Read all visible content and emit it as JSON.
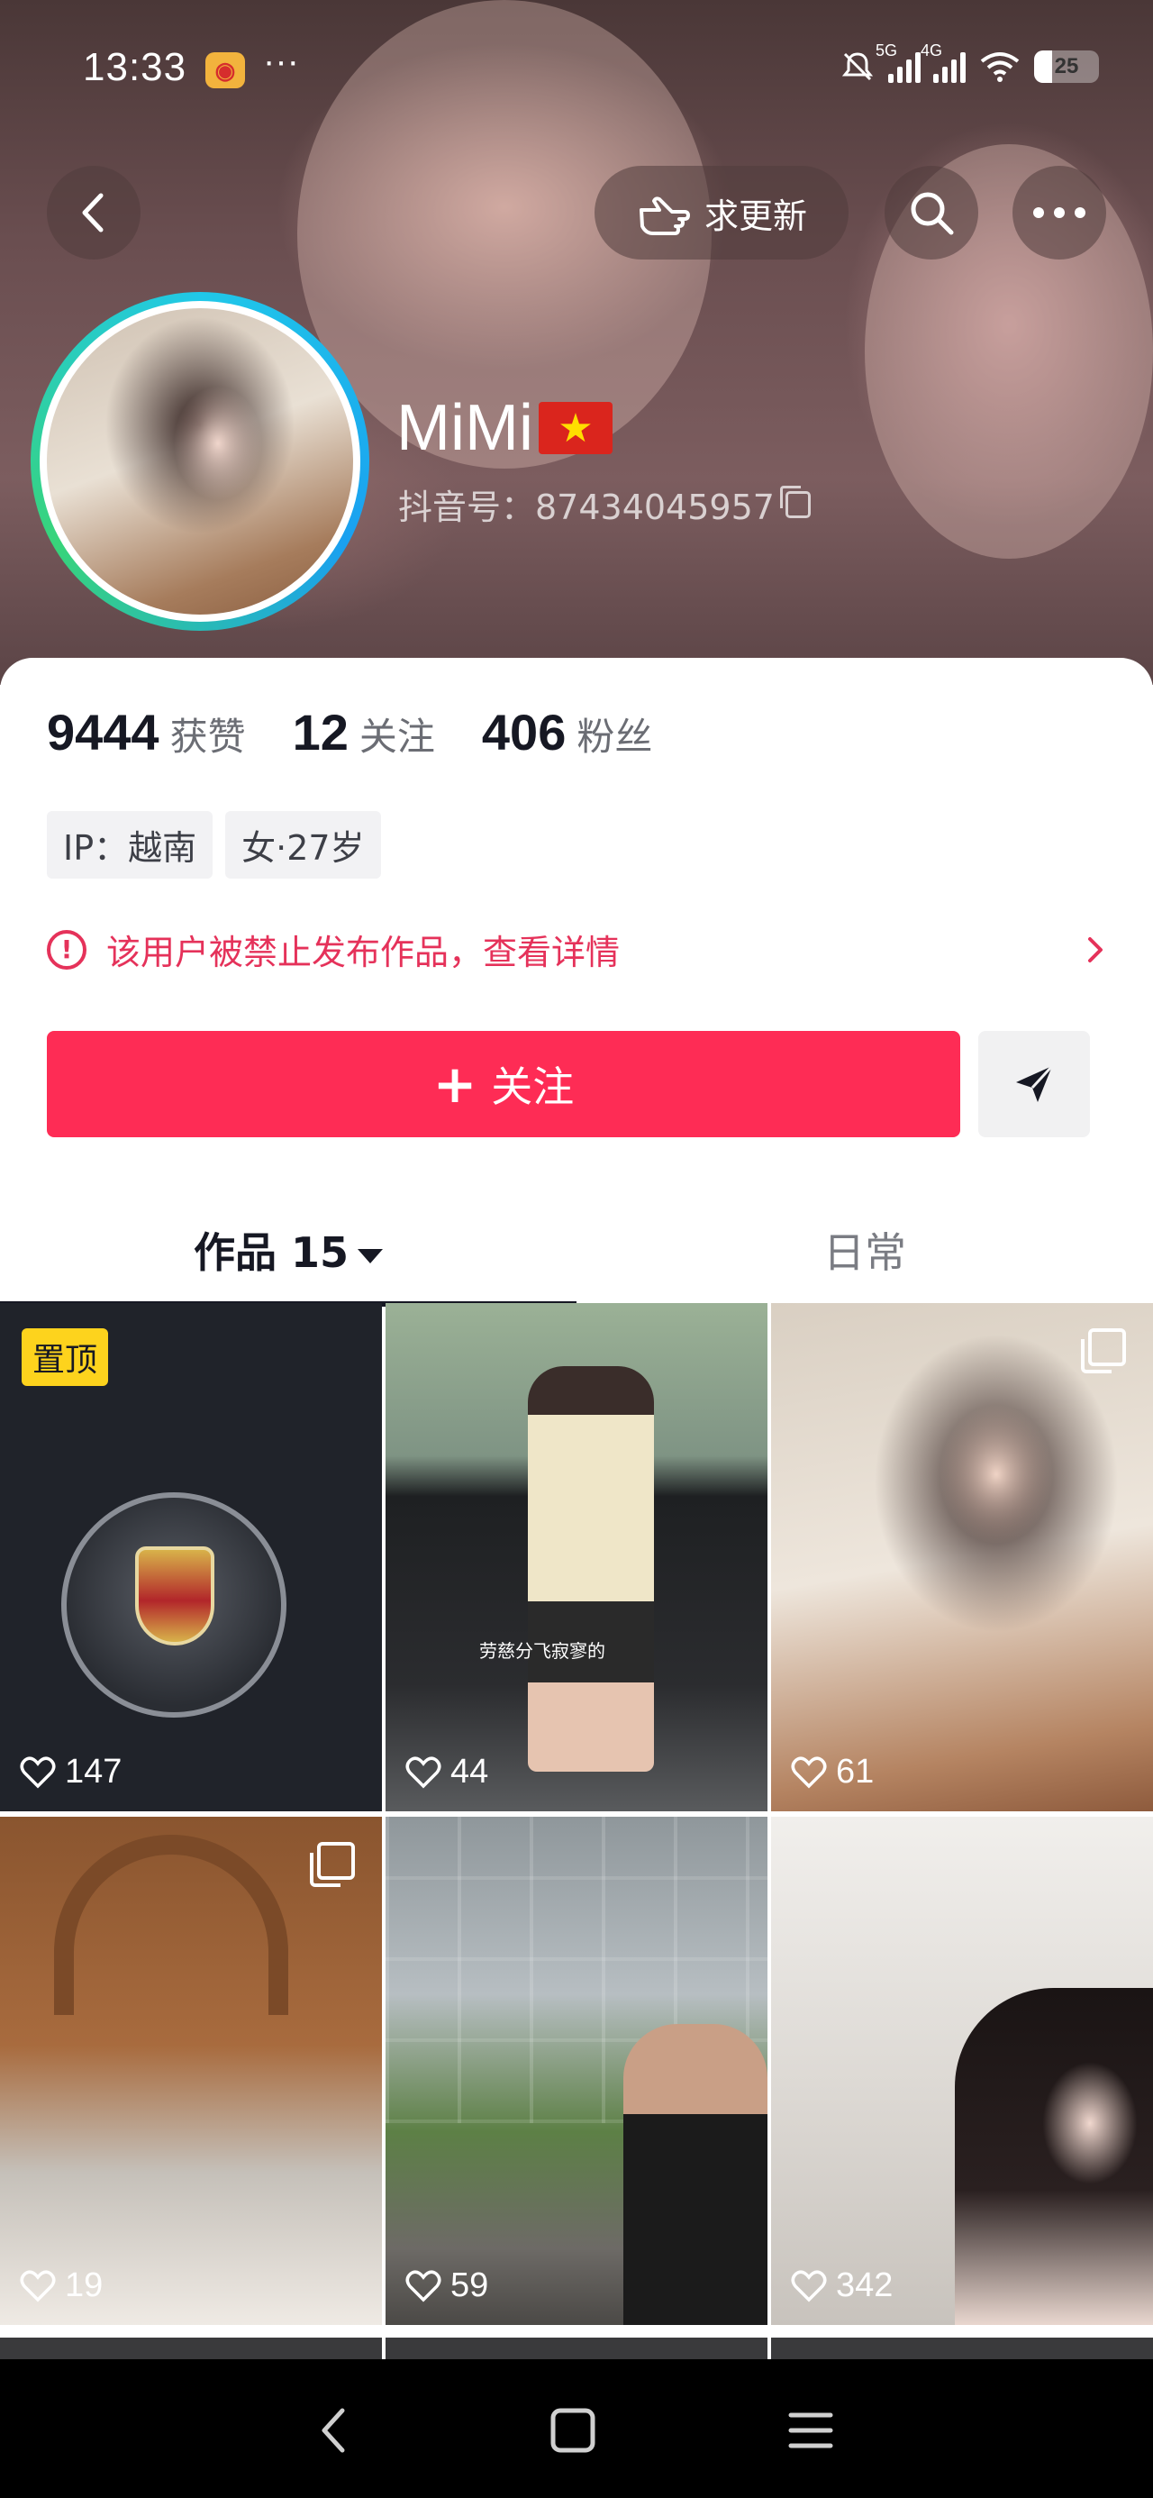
{
  "status_bar": {
    "time": "13:33",
    "app_icon": "weibo-icon",
    "more_dots": "···",
    "network_5g": "5G",
    "network_4g": "4G",
    "battery": "25"
  },
  "header": {
    "back_icon": "back-arrow-icon",
    "request_update_label": "求更新",
    "search_icon": "search-icon",
    "more_icon": "more-icon"
  },
  "profile": {
    "name": "MiMi",
    "flag": "vietnam-flag",
    "douyin_id_label": "抖音号：87434045957"
  },
  "stats": [
    {
      "value": "9444",
      "label": "获赞"
    },
    {
      "value": "12",
      "label": "关注"
    },
    {
      "value": "406",
      "label": "粉丝"
    }
  ],
  "tags": [
    "IP：越南",
    "女·27岁"
  ],
  "notice": {
    "text": "该用户被禁止发布作品，查看详情"
  },
  "actions": {
    "follow_label": "关注",
    "follow_color": "#fe2c55"
  },
  "tabs": {
    "works_label": "作品 15",
    "daily_label": "日常"
  },
  "grid": {
    "pinned_label": "置顶",
    "caption": "劳慈分飞寂寥的",
    "items": [
      {
        "likes": "147"
      },
      {
        "likes": "44"
      },
      {
        "likes": "61"
      },
      {
        "likes": "19"
      },
      {
        "likes": "59"
      },
      {
        "likes": "342"
      }
    ]
  }
}
